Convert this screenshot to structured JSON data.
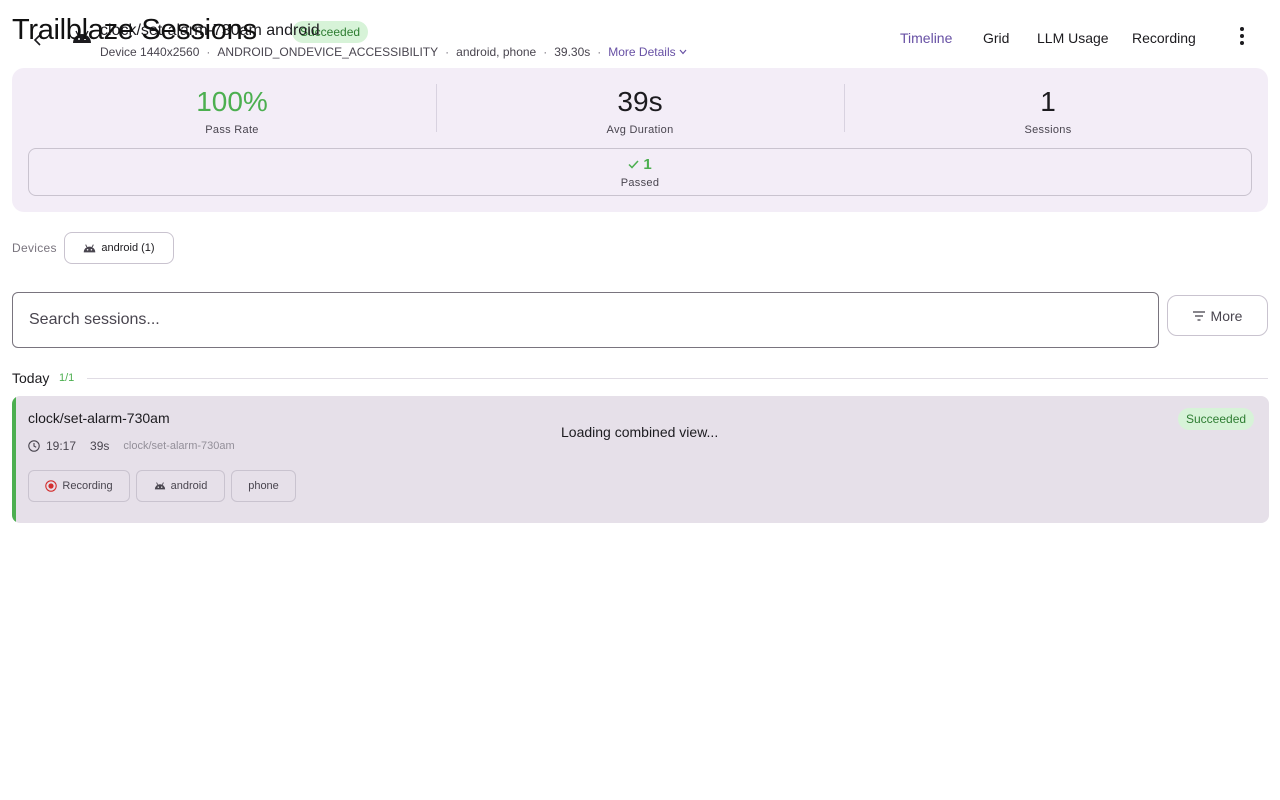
{
  "app": {
    "title": "Trailblaze Sessions"
  },
  "header": {
    "session_title": "clock/set-alarm-730am android",
    "status": "Succeeded",
    "meta": {
      "device": "Device 1440x2560",
      "driver": "ANDROID_ONDEVICE_ACCESSIBILITY",
      "tags": "android, phone",
      "duration": "39.30s",
      "more_details": "More Details"
    },
    "tabs": [
      {
        "label": "Timeline",
        "active": true
      },
      {
        "label": "Grid",
        "active": false
      },
      {
        "label": "LLM Usage",
        "active": false
      },
      {
        "label": "Recording",
        "active": false
      }
    ],
    "icons": {
      "back": "back-arrow-icon",
      "platform": "android-icon",
      "overflow": "more-vert-icon"
    }
  },
  "stats": {
    "pass_rate": {
      "value": "100%",
      "label": "Pass Rate"
    },
    "avg_duration": {
      "value": "39s",
      "label": "Avg Duration"
    },
    "sessions": {
      "value": "1",
      "label": "Sessions"
    },
    "passed": {
      "count": "1",
      "label": "Passed"
    }
  },
  "devices": {
    "label": "Devices",
    "chips": [
      {
        "label": "android (1)"
      }
    ]
  },
  "search": {
    "placeholder": "Search sessions...",
    "value": ""
  },
  "more_button": {
    "label": "More"
  },
  "groups": [
    {
      "title": "Today",
      "count": "1/1",
      "sessions": [
        {
          "name": "clock/set-alarm-730am",
          "time": "19:17",
          "duration": "39s",
          "id": "clock/set-alarm-730am",
          "status": "Succeeded",
          "loading_text": "Loading combined view...",
          "chips": [
            {
              "label": "Recording",
              "icon": "record-icon"
            },
            {
              "label": "android",
              "icon": "android-icon"
            },
            {
              "label": "phone",
              "icon": ""
            }
          ]
        }
      ]
    }
  ],
  "colors": {
    "accent": "#6750a4",
    "success": "#4caf50",
    "success_bg": "#d7f3d8",
    "card_bg": "#f3edf7",
    "session_bg": "#e6e0e9",
    "record_red": "#d32f2f"
  }
}
